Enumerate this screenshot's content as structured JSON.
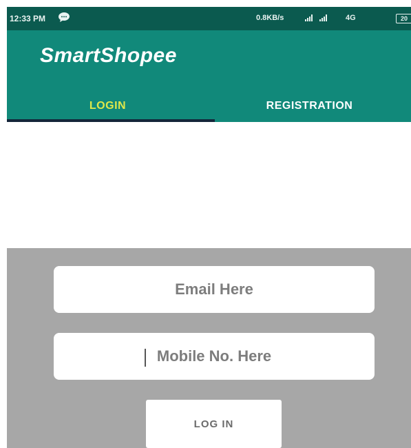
{
  "status_bar": {
    "time": "12:33 PM",
    "chat_icon": "chat-bubble-icon",
    "network_speed": "0.8KB/s",
    "network_type": "4G",
    "battery": "20"
  },
  "app_bar": {
    "title": "SmartShopee",
    "background_color": "#11897a",
    "tabs": [
      {
        "label": "LOGIN",
        "selected": true,
        "color": "#dfe84a"
      },
      {
        "label": "REGISTRATION",
        "selected": false,
        "color": "#ffffff"
      }
    ]
  },
  "login_form": {
    "background_color": "#a7a7a7",
    "email": {
      "placeholder": "Email Here",
      "value": ""
    },
    "mobile": {
      "placeholder": "Mobile No. Here",
      "value": ""
    },
    "submit_label": "LOG IN"
  }
}
